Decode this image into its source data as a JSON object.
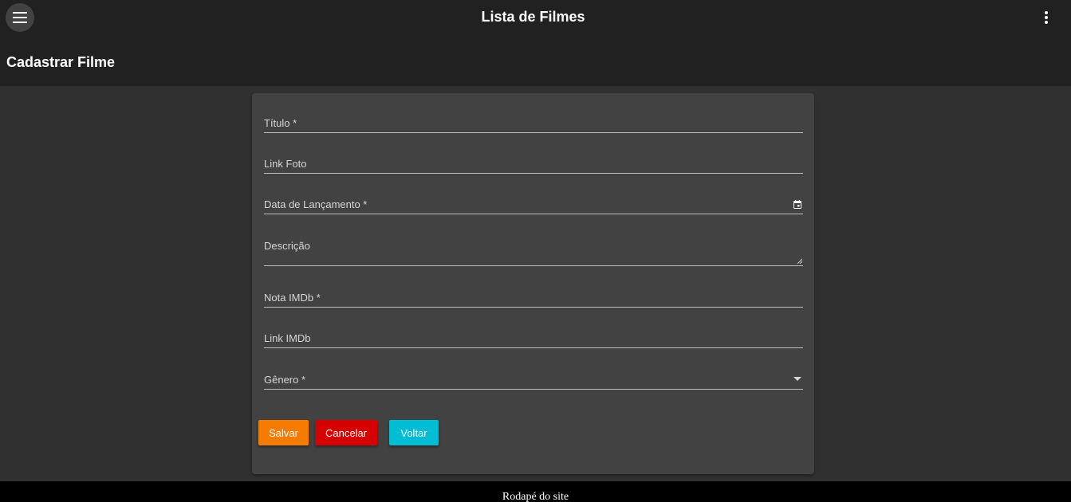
{
  "header": {
    "app_title": "Lista de Filmes",
    "menu_icon": "menu-icon",
    "more_icon": "more-vert-icon"
  },
  "page": {
    "title": "Cadastrar Filme"
  },
  "form": {
    "fields": [
      {
        "label": "Título *",
        "value": ""
      },
      {
        "label": "Link Foto",
        "value": ""
      },
      {
        "label": "Data de Lançamento *",
        "value": "",
        "icon": "calendar-icon"
      },
      {
        "label": "Descrição",
        "value": ""
      },
      {
        "label": "Nota IMDb *",
        "value": ""
      },
      {
        "label": "Link IMDb",
        "value": ""
      },
      {
        "label": "Gênero *",
        "value": "",
        "icon": "dropdown-arrow-icon"
      }
    ],
    "buttons": {
      "save": "Salvar",
      "cancel": "Cancelar",
      "back": "Voltar"
    }
  },
  "footer": {
    "text": "Rodapé do site"
  },
  "colors": {
    "save": "#f57c00",
    "cancel": "#d50000",
    "back": "#00bcd4",
    "card": "#424242",
    "header": "#212121",
    "background": "#303030"
  }
}
